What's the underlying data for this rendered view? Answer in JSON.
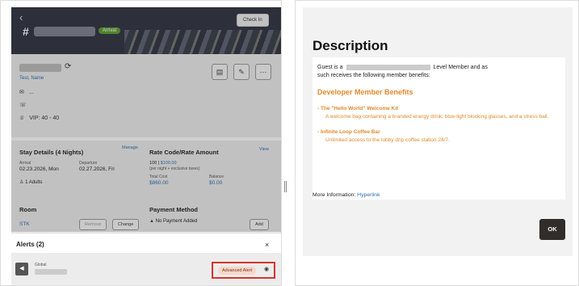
{
  "reservation": {
    "back_glyph": "‹",
    "hash": "#",
    "status_badge": "Arrival",
    "check_in_label": "Check In"
  },
  "guest": {
    "link": "Test, Name",
    "email_glyph": "✉",
    "email_value": "...",
    "phone_glyph": "☏",
    "vip_glyph": "♕",
    "vip_text": "VIP: 40 - 40",
    "action_icons": [
      "document-icon",
      "notes-icon",
      "more-icon"
    ]
  },
  "stay": {
    "title": "Stay Details (4 Nights)",
    "manage": "Manage",
    "arrival_label": "Arrival",
    "arrival_value": "02.23.2026, Mon",
    "departure_label": "Departure",
    "departure_value": "02.27.2026, Fri",
    "adults": "1 Adults"
  },
  "rate": {
    "title": "Rate Code/Rate Amount",
    "view": "View",
    "line1_prefix": "100 |",
    "line1_amount": "$100.00",
    "line2": "(per night + exclusive taxes)",
    "total_label": "Total Cost",
    "total_value": "$860.00",
    "balance_label": "Balance",
    "balance_value": "$0.00"
  },
  "room": {
    "title": "Room",
    "code": "STK",
    "remove": "Remove",
    "change": "Change"
  },
  "payment": {
    "title": "Payment Method",
    "warning": "No Payment Added",
    "add": "Add"
  },
  "alerts": {
    "title": "Alerts (2)",
    "close": "×",
    "scope": "Global",
    "badge": "Advanced Alert",
    "eye": "◉"
  },
  "modal": {
    "title": "Description",
    "guest_prefix": "Guest is a",
    "guest_suffix": "Level Member  and as",
    "guest_line2": "such receives the following member benefits:",
    "benefits_title": "Developer Member Benefits",
    "benefit1_title": "- The \"Hello World\" Welcome Kit",
    "benefit1_desc": "A welcome bag containing a branded energy drink, blue-light blocking glasses, and a stress ball.",
    "benefit2_title": "- Infinite Loop Coffee Bar",
    "benefit2_desc": "Unlimited access to the lobby drip coffee station 24/7.",
    "more_prefix": "More Information:",
    "more_link": "Hyperlink",
    "ok": "OK"
  }
}
